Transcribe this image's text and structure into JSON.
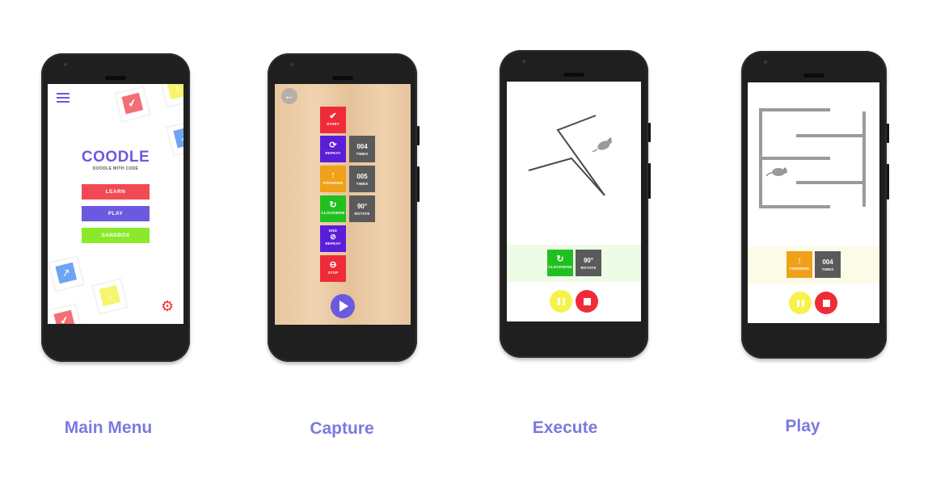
{
  "captions": {
    "main_menu": "Main Menu",
    "capture": "Capture",
    "execute": "Execute",
    "play": "Play"
  },
  "main_menu": {
    "app_title": "COODLE",
    "tagline": "DOODLE WITH CODE",
    "buttons": [
      "LEARN",
      "PLAY",
      "SANDBOX"
    ],
    "tile_labels": [
      "START",
      "RIGHT",
      "REPEAT"
    ],
    "icons": [
      "hamburger-icon",
      "gear-icon"
    ]
  },
  "capture": {
    "blocks": [
      {
        "label": "START",
        "icon": "✔",
        "color": "#f02b38"
      },
      {
        "label": "REPEAT",
        "icon": "⟳",
        "color": "#5b1ed8"
      },
      {
        "label": "FORWARD",
        "icon": "↑",
        "color": "#f0a11a"
      },
      {
        "label": "CLOCKWISE",
        "icon": "↻",
        "color": "#20c020"
      },
      {
        "label": "REPEAT",
        "pre": "END",
        "icon": "⊘",
        "color": "#5b1ed8"
      },
      {
        "label": "STOP",
        "icon": "⊖",
        "color": "#f02b38"
      }
    ],
    "params": [
      {
        "value": "004",
        "label": "TIMES"
      },
      {
        "value": "005",
        "label": "TIMES"
      },
      {
        "value": "90°",
        "label": "ROTATE"
      }
    ]
  },
  "execute": {
    "blocks": [
      {
        "label": "CLOCKWISE",
        "icon": "↻",
        "color": "#20c020"
      },
      {
        "value": "90°",
        "label": "ROTATE",
        "color": "#5a5a5a"
      }
    ]
  },
  "play": {
    "blocks": [
      {
        "label": "FORWARD",
        "icon": "↑",
        "color": "#f0a11a"
      },
      {
        "value": "004",
        "label": "TIMES",
        "color": "#5a5a5a"
      }
    ]
  },
  "colors": {
    "caption": "#7a7ae0",
    "red": "#f02b38",
    "purple": "#5b1ed8",
    "orange": "#f0a11a",
    "green": "#20c020",
    "grey": "#5a5a5a",
    "yellow": "#f6f24a"
  }
}
